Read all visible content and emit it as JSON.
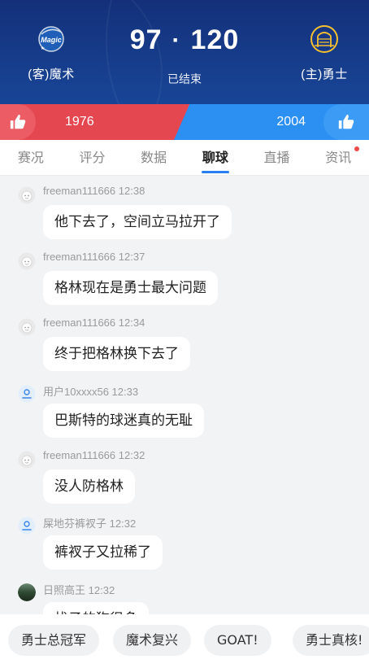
{
  "header": {
    "away_team": "(客)魔术",
    "home_team": "(主)勇士",
    "away_score": "97",
    "separator": "·",
    "home_score": "120",
    "status": "已结束",
    "away_logo_text": "Magic"
  },
  "vote": {
    "away_count": "1976",
    "home_count": "2004"
  },
  "tabs": [
    {
      "label": "赛况"
    },
    {
      "label": "评分"
    },
    {
      "label": "数据"
    },
    {
      "label": "聊球"
    },
    {
      "label": "直播"
    },
    {
      "label": "资讯"
    }
  ],
  "messages": [
    {
      "user": "freeman111666",
      "time": "12:38",
      "text": "他下去了，空间立马拉开了"
    },
    {
      "user": "freeman111666",
      "time": "12:37",
      "text": "格林现在是勇士最大问题"
    },
    {
      "user": "freeman111666",
      "time": "12:34",
      "text": "终于把格林换下去了"
    },
    {
      "user": "用户10xxxx56",
      "time": "12:33",
      "text": "巴斯特的球迷真的无耻"
    },
    {
      "user": "freeman111666",
      "time": "12:32",
      "text": "没人防格林"
    },
    {
      "user": "屎地芬裤衩子",
      "time": "12:32",
      "text": "裤衩子又拉稀了"
    },
    {
      "user": "日照高王",
      "time": "12:32",
      "text": "找子的狗很多"
    }
  ],
  "chips": [
    {
      "label": "勇士总冠军"
    },
    {
      "label": "魔术复兴"
    },
    {
      "label": "GOAT!"
    },
    {
      "label": "勇士真核!"
    }
  ],
  "colors": {
    "header_bg": "#17408f",
    "vote_red": "#e4474f",
    "vote_blue": "#2c8ff2",
    "tab_accent": "#2a7ff0"
  }
}
